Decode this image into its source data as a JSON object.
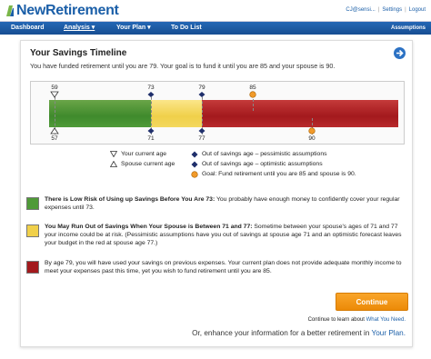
{
  "brand": {
    "name": "NewRetirement"
  },
  "user": {
    "email": "CJ@sensi...",
    "settings": "Settings",
    "logout": "Logout"
  },
  "nav": {
    "items": [
      {
        "label": "Dashboard"
      },
      {
        "label": "Analysis ▾"
      },
      {
        "label": "Your Plan ▾"
      },
      {
        "label": "To Do List"
      }
    ],
    "right": "Assumptions"
  },
  "timeline": {
    "title": "Your Savings Timeline",
    "subtitle": "You have funded retirement until you are 79. Your goal is to fund it until you are 85 and your spouse is 90.",
    "top_ticks": [
      "59",
      "73",
      "79",
      "85"
    ],
    "bottom_ticks": [
      "57",
      "71",
      "77",
      "90"
    ],
    "zones": [
      {
        "name": "green",
        "from_age": 59,
        "to_age": 73
      },
      {
        "name": "yellow",
        "from_age": 73,
        "to_age": 79
      },
      {
        "name": "red",
        "from_age": 79,
        "to_age": 99
      }
    ],
    "colors": {
      "green": "#4f9a38",
      "yellow": "#f0d04a",
      "red": "#a3191d",
      "navy": "#1f2f6b",
      "orange": "#f19a2a"
    }
  },
  "legend": {
    "left": [
      "Your current age",
      "Spouse current age"
    ],
    "right": [
      "Out of savings age – pessimistic assumptions",
      "Out of savings age – optimistic assumptions",
      "Goal: Fund retirement until you are 85 and spouse is 90."
    ]
  },
  "info": [
    {
      "bold": "There is Low Risk of Using up Savings Before You Are 73:",
      "text": " You probably have enough money to confidently cover your regular expenses until 73."
    },
    {
      "bold": "You May Run Out of Savings When Your Spouse is Between 71 and 77:",
      "text": " Sometime between your spouse's ages of 71 and 77 your income could be at risk. (Pessimistic assumptions have you out of savings at spouse age 71 and an optimistic forecast leaves your budget in the red at spouse age 77.)"
    },
    {
      "bold": "",
      "text": "By age 79, you will have used your savings on previous expenses. Your current plan does not provide adequate monthly income to meet your expenses past this time, yet you wish to fund retirement until you are 85."
    }
  ],
  "actions": {
    "continue": "Continue",
    "learn_prefix": "Continue to learn about ",
    "learn_link": "What You Need.",
    "enhance_prefix": "Or, enhance your information for a better retirement in ",
    "enhance_link": "Your Plan."
  }
}
